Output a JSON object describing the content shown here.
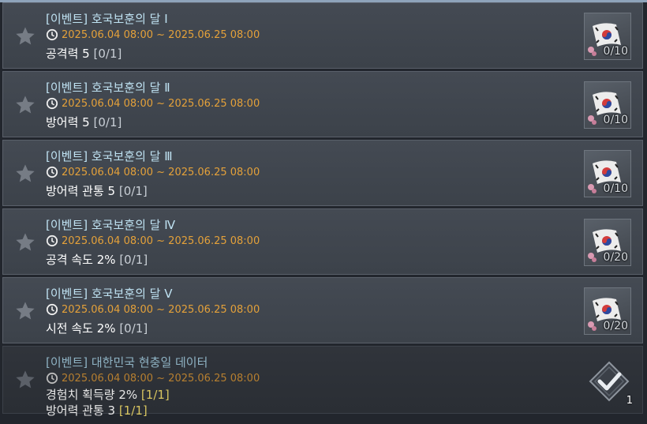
{
  "missions": [
    {
      "title": "[이벤트] 호국보훈의 달 Ⅰ",
      "period": "2025.06.04 08:00 ~ 2025.06.25 08:00",
      "requirements": [
        {
          "text": "공격력 5",
          "count": "[0/1]"
        }
      ],
      "reward_progress": "0/10",
      "completed": false
    },
    {
      "title": "[이벤트] 호국보훈의 달 Ⅱ",
      "period": "2025.06.04 08:00 ~ 2025.06.25 08:00",
      "requirements": [
        {
          "text": "방어력 5",
          "count": "[0/1]"
        }
      ],
      "reward_progress": "0/10",
      "completed": false
    },
    {
      "title": "[이벤트] 호국보훈의 달 Ⅲ",
      "period": "2025.06.04 08:00 ~ 2025.06.25 08:00",
      "requirements": [
        {
          "text": "방어력 관통 5",
          "count": "[0/1]"
        }
      ],
      "reward_progress": "0/10",
      "completed": false
    },
    {
      "title": "[이벤트] 호국보훈의 달 Ⅳ",
      "period": "2025.06.04 08:00 ~ 2025.06.25 08:00",
      "requirements": [
        {
          "text": "공격 속도 2%",
          "count": "[0/1]"
        }
      ],
      "reward_progress": "0/20",
      "completed": false
    },
    {
      "title": "[이벤트] 호국보훈의 달 Ⅴ",
      "period": "2025.06.04 08:00 ~ 2025.06.25 08:00",
      "requirements": [
        {
          "text": "시전 속도 2%",
          "count": "[0/1]"
        }
      ],
      "reward_progress": "0/20",
      "completed": false
    },
    {
      "title": "[이벤트] 대한민국 현충일 데이터",
      "period": "2025.06.04 08:00 ~ 2025.06.25 08:00",
      "requirements": [
        {
          "text": "경험치 획득량 2%",
          "count": "[1/1]"
        },
        {
          "text": "방어력 관통 3",
          "count": "[1/1]"
        }
      ],
      "reward_quantity": "1",
      "completed": true
    }
  ],
  "colors": {
    "title": "#bfe2f2",
    "period": "#e4a13a",
    "requirement": "#ffffff",
    "completed_count": "#d8c560"
  },
  "icons": {
    "star": "star-icon",
    "clock": "clock-icon",
    "reward": "korean-flag-icon",
    "completed": "checkmark-badge-icon"
  }
}
